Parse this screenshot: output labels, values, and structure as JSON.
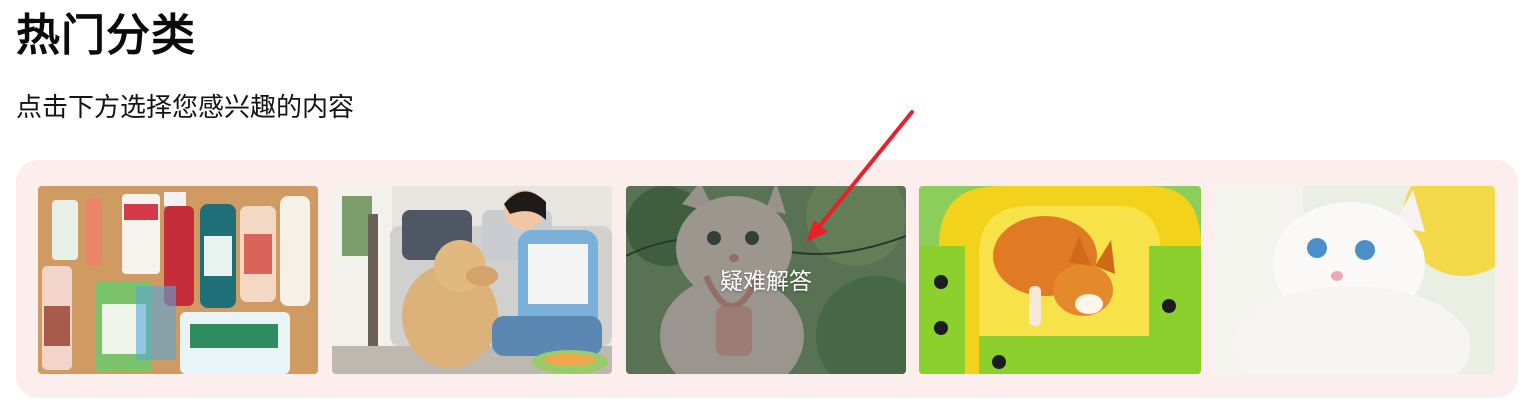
{
  "header": {
    "title": "热门分类",
    "subtitle": "点击下方选择您感兴趣的内容"
  },
  "categories": [
    {
      "icon": "pet-supplies-image",
      "label": ""
    },
    {
      "icon": "dog-training-image",
      "label": ""
    },
    {
      "icon": "cat-faq-image",
      "label": "疑难解答"
    },
    {
      "icon": "corgi-play-image",
      "label": ""
    },
    {
      "icon": "white-cat-image",
      "label": ""
    }
  ],
  "colors": {
    "panel_background": "#fdeeee",
    "annotation_arrow": "#e8202a",
    "hover_overlay": "rgba(40,50,60,0.42)"
  }
}
